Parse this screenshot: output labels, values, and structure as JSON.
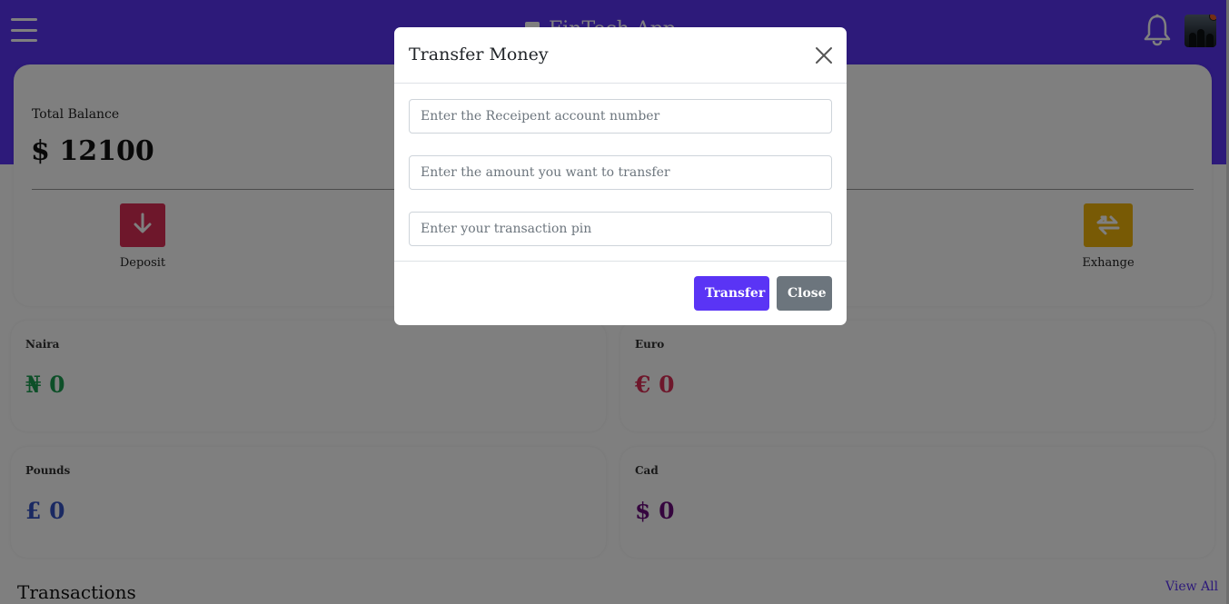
{
  "header": {
    "brand": "FinTech App",
    "menu_icon": "hamburger-menu-icon",
    "notification_icon": "bell-icon",
    "avatar": "user-avatar"
  },
  "balance": {
    "label": "Total Balance",
    "value": "$ 12100",
    "actions": [
      {
        "label": "Deposit",
        "icon": "arrow-down-icon",
        "color": "#dc2f57"
      },
      {
        "label": "Exhange",
        "icon": "exchange-arrows-icon",
        "color": "#f0b40b"
      }
    ]
  },
  "wallets": [
    {
      "name": "Naira",
      "amount": "₦ 0",
      "color": "#1a9e50"
    },
    {
      "name": "Euro",
      "amount": "€ 0",
      "color": "#dc2f57"
    },
    {
      "name": "Pounds",
      "amount": "£ 0",
      "color": "#3553c4"
    },
    {
      "name": "Cad",
      "amount": "$ 0",
      "color": "#6a0b7d"
    }
  ],
  "transactions": {
    "title": "Transactions",
    "view_all": "View All"
  },
  "modal": {
    "title": "Transfer Money",
    "account_placeholder": "Enter the Receipent account number",
    "amount_placeholder": "Enter the amount you want to transfer",
    "pin_placeholder": "Enter your transaction pin",
    "transfer_label": "Transfer",
    "close_label": "Close"
  },
  "colors": {
    "primary": "#5a34f5",
    "secondary": "#6c757d",
    "overlay": "rgba(0,0,0,0.5)"
  }
}
